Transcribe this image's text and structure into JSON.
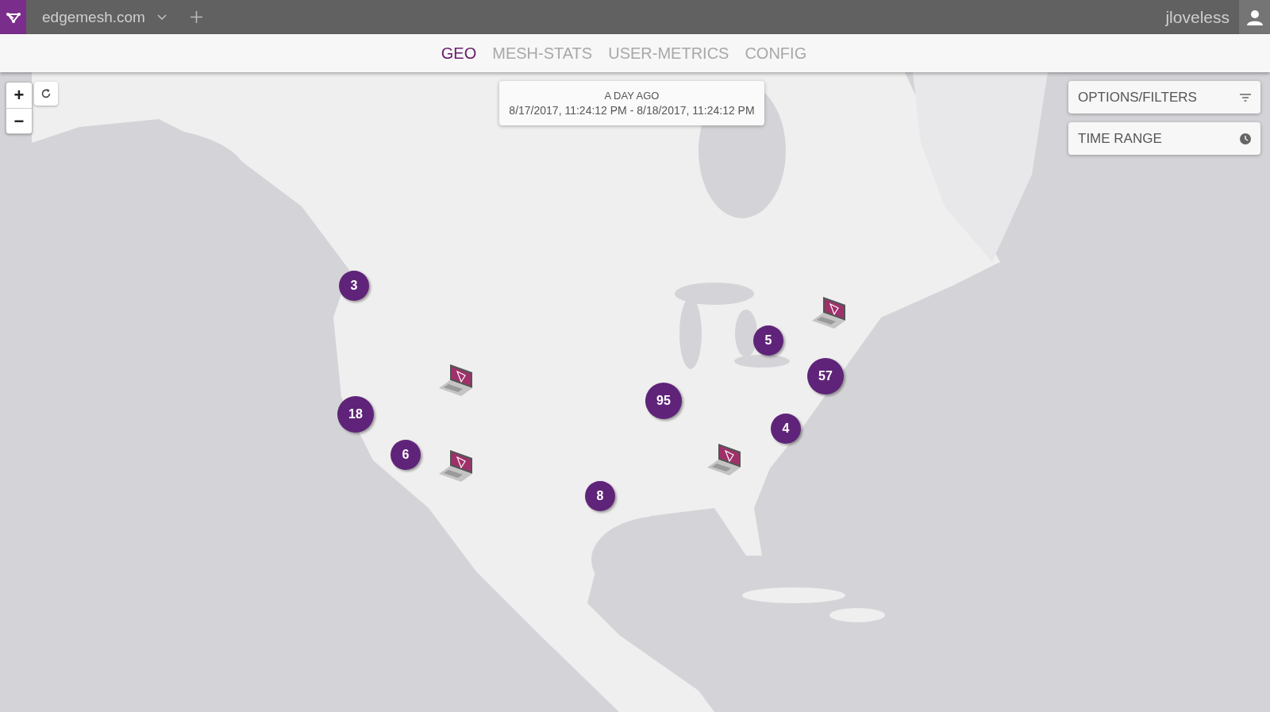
{
  "app": {
    "domain": "edgemesh.com",
    "user": "jloveless"
  },
  "tabs": [
    {
      "label": "GEO",
      "selected": true
    },
    {
      "label": "MESH-STATS",
      "selected": false
    },
    {
      "label": "USER-METRICS",
      "selected": false
    },
    {
      "label": "CONFIG",
      "selected": false
    }
  ],
  "zoom_controls": [
    "+",
    "−"
  ],
  "time_window": {
    "relative": "A DAY AGO",
    "range": "8/17/2017, 11:24:12 PM - 8/18/2017, 11:24:12 PM"
  },
  "panels": [
    {
      "label": "OPTIONS/FILTERS",
      "kind": "filters"
    },
    {
      "label": "TIME RANGE",
      "kind": "time"
    }
  ],
  "map": {
    "markers": [
      {
        "kind": "cluster",
        "count": "3"
      },
      {
        "kind": "device"
      },
      {
        "kind": "cluster",
        "count": "5"
      },
      {
        "kind": "cluster",
        "count": "57"
      },
      {
        "kind": "device"
      },
      {
        "kind": "cluster",
        "count": "95"
      },
      {
        "kind": "cluster",
        "count": "18"
      },
      {
        "kind": "cluster",
        "count": "4"
      },
      {
        "kind": "cluster",
        "count": "6"
      },
      {
        "kind": "device"
      },
      {
        "kind": "device"
      },
      {
        "kind": "cluster",
        "count": "8"
      }
    ]
  }
}
